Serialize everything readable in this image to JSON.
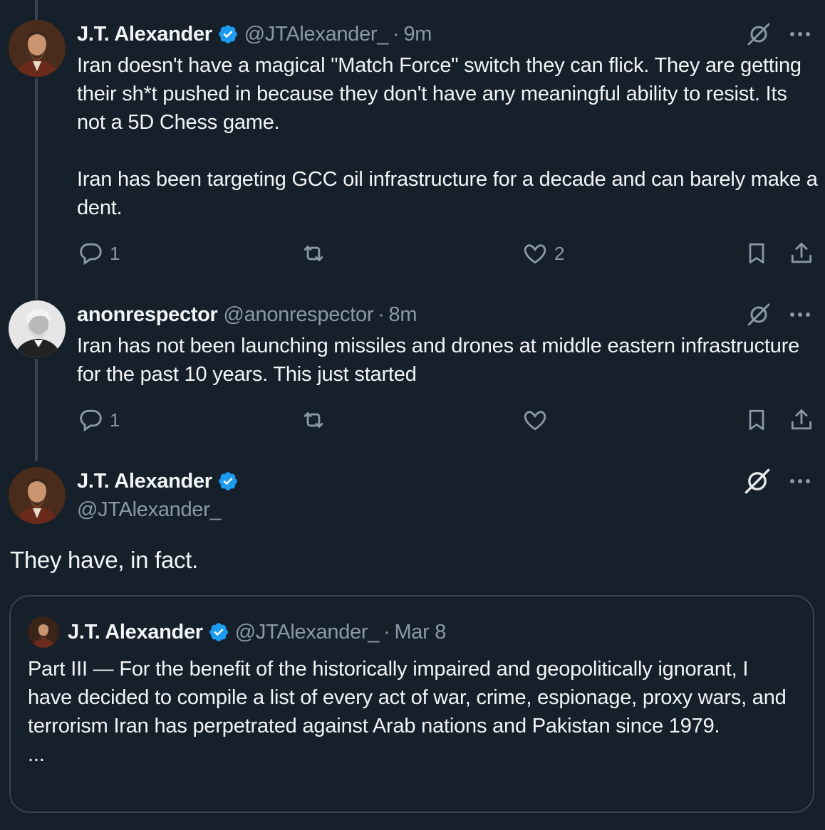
{
  "colors": {
    "background": "#16202b",
    "text_primary": "#f2f4f6",
    "text_secondary": "#8b98a5",
    "verified_blue": "#1d9bf0",
    "thread_line": "#38444d"
  },
  "tweets": [
    {
      "name": "J.T. Alexander",
      "verified": true,
      "handle": "@JTAlexander_",
      "separator": "·",
      "time": "9m",
      "paragraphs": [
        "Iran doesn't have a magical \"Match Force\" switch they can flick. They are getting their sh*t pushed in because they don't have any meaningful ability to resist. Its not a 5D Chess game.",
        "Iran has been targeting GCC oil infrastructure for a decade and can barely make a dent."
      ],
      "replies": "1",
      "reposts": "",
      "likes": "2",
      "icons": [
        "grok-icon",
        "more-icon",
        "reply-icon",
        "repost-icon",
        "like-icon",
        "bookmark-icon",
        "share-icon"
      ]
    },
    {
      "name": "anonrespector",
      "verified": false,
      "handle": "@anonrespector",
      "separator": "·",
      "time": "8m",
      "paragraphs": [
        "Iran has not been launching missiles and drones at middle eastern infrastructure for the past 10 years. This just started"
      ],
      "replies": "1",
      "reposts": "",
      "likes": ""
    }
  ],
  "main_tweet": {
    "name": "J.T. Alexander",
    "verified": true,
    "handle": "@JTAlexander_",
    "text": "They have, in fact.",
    "quote": {
      "name": "J.T. Alexander",
      "verified": true,
      "handle": "@JTAlexander_",
      "separator": "·",
      "time": "Mar 8",
      "text": "Part III — For the benefit of the historically impaired and geopolitically ignorant, I have decided to compile a list of every act of war, crime, espionage, proxy wars, and terrorism Iran has perpetrated against Arab nations and Pakistan since 1979.",
      "more": "..."
    }
  }
}
